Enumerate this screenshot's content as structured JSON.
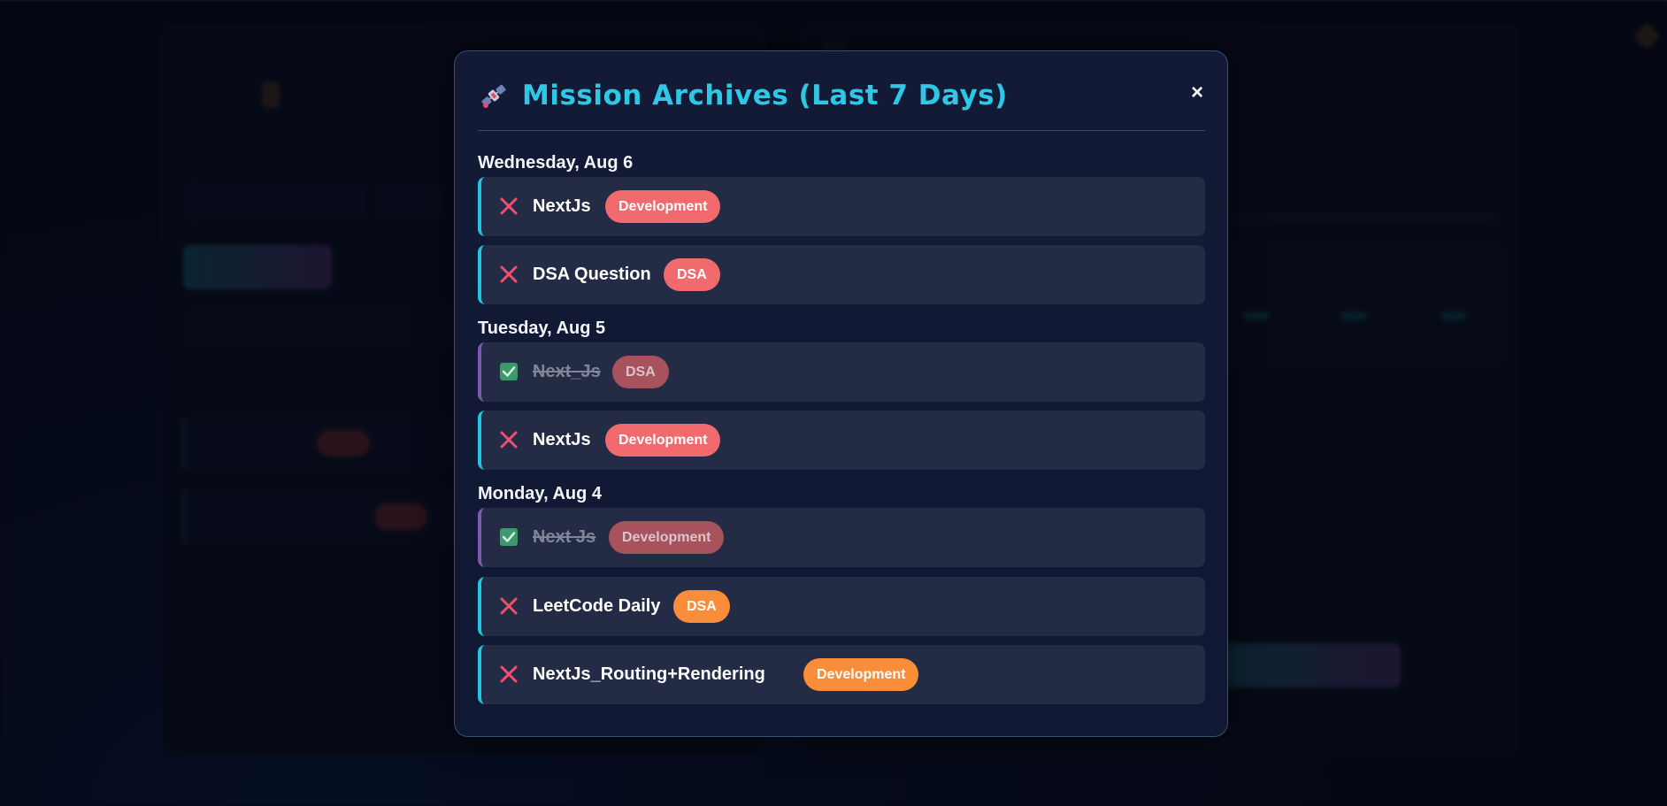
{
  "modal": {
    "title": "Mission Archives (Last 7 Days)",
    "close_label": "×",
    "days": [
      {
        "heading": "Wednesday, Aug 6",
        "tasks": [
          {
            "name": "NextJs",
            "tag": "Development",
            "tag_color": "#f06a6e",
            "completed": false
          },
          {
            "name": "DSA Question",
            "tag": "DSA",
            "tag_color": "#f06a6e",
            "completed": false
          }
        ]
      },
      {
        "heading": "Tuesday, Aug 5",
        "tasks": [
          {
            "name": "Next_Js",
            "tag": "DSA",
            "tag_color": "#a7525d",
            "completed": true
          },
          {
            "name": "NextJs",
            "tag": "Development",
            "tag_color": "#f06a6e",
            "completed": false
          }
        ]
      },
      {
        "heading": "Monday, Aug 4",
        "tasks": [
          {
            "name": "Next Js",
            "tag": "Development",
            "tag_color": "#a7525d",
            "completed": true
          },
          {
            "name": "LeetCode Daily",
            "tag": "DSA",
            "tag_color": "#fa8d3a",
            "completed": false
          },
          {
            "name": "NextJs_Routing+Rendering",
            "tag": "Development",
            "tag_color": "#fa8d3a",
            "completed": false
          }
        ]
      }
    ]
  },
  "colors": {
    "accent_cyan": "#2ec8e6",
    "fail_x": "#f0506e",
    "done_check": "#3c9a6a",
    "modal_bg": "#121a35",
    "card_bg": "#232b45"
  },
  "icons": {
    "title_icon": "satellite-icon",
    "failed_icon": "x-mark-icon",
    "done_icon": "checkbox-checked-icon"
  }
}
